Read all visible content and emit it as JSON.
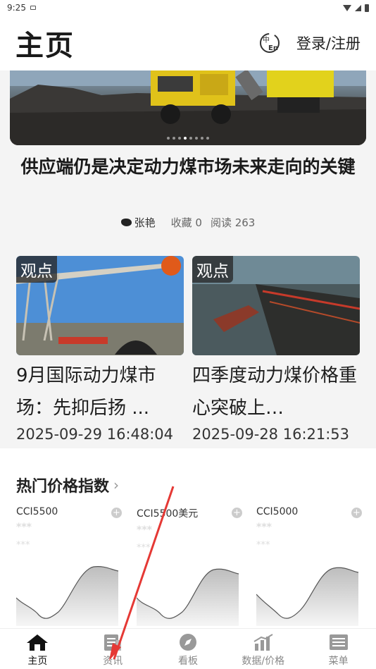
{
  "status_bar": {
    "time": "9:25"
  },
  "header": {
    "title": "主页",
    "login_label": "登录/注册",
    "lang_icon": "zh-en-switch-icon"
  },
  "banner": {
    "slide_count": 8,
    "active_slide": 3
  },
  "feature": {
    "title": "供应端仍是决定动力煤市场未来走向的关键",
    "author": "张艳",
    "favorites": "收藏 0",
    "reads": "阅读 263"
  },
  "articles": [
    {
      "tag": "观点",
      "title": "9月国际动力煤市场：先抑后扬 ...",
      "date": "2025-09-29 16:48:04"
    },
    {
      "tag": "观点",
      "title": "四季度动力煤价格重心突破上…",
      "date": "2025-09-28 16:21:53"
    }
  ],
  "hot_index": {
    "title": "热门价格指数",
    "items": [
      {
        "name": "CCI5500",
        "value": "***",
        "change": "***"
      },
      {
        "name": "CCI5500美元",
        "value": "***",
        "change": "***"
      },
      {
        "name": "CCI5000",
        "value": "***",
        "change": "***"
      }
    ]
  },
  "tabbar": {
    "tabs": [
      {
        "label": "主页",
        "icon": "home-icon",
        "active": true
      },
      {
        "label": "资讯",
        "icon": "news-icon",
        "active": false
      },
      {
        "label": "看板",
        "icon": "compass-icon",
        "active": false
      },
      {
        "label": "数据/价格",
        "icon": "bar-chart-icon",
        "active": false
      },
      {
        "label": "菜单",
        "icon": "menu-icon",
        "active": false
      }
    ]
  },
  "colors": {
    "accent": "#111111",
    "annotation_arrow": "#e53935"
  }
}
